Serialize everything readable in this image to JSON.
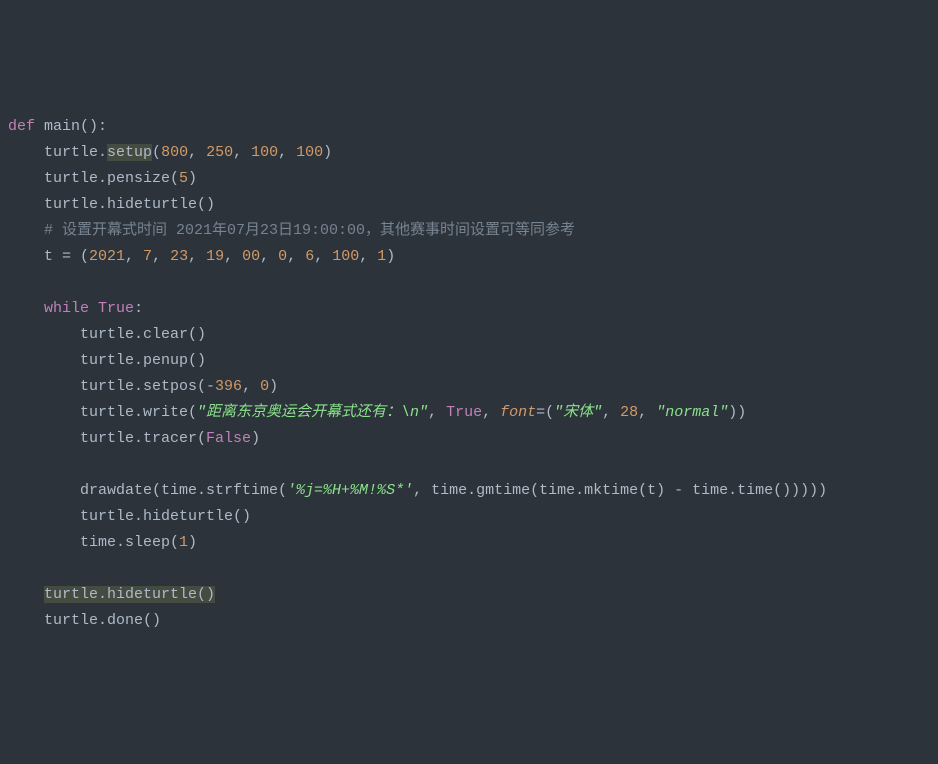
{
  "code": {
    "l1": {
      "def": "def",
      "name": "main",
      "rest": "():"
    },
    "l2": {
      "p1": "    turtle.",
      "hl": "setup",
      "p2": "(",
      "n1": "800",
      "c1": ", ",
      "n2": "250",
      "c2": ", ",
      "n3": "100",
      "c3": ", ",
      "n4": "100",
      "p3": ")"
    },
    "l3": {
      "p1": "    turtle.pensize(",
      "n1": "5",
      "p2": ")"
    },
    "l4": {
      "p1": "    turtle.hideturtle()"
    },
    "l5": {
      "cmt": "    # 设置开幕式时间 2021年07月23日19:00:00，其他赛事时间设置可等同参考"
    },
    "l6": {
      "p1": "    t = (",
      "n1": "2021",
      "c": ", ",
      "n2": "7",
      "n3": "23",
      "n4": "19",
      "n5": "00",
      "n6": "0",
      "n7": "6",
      "n8": "100",
      "n9": "1",
      "p2": ")"
    },
    "l7": {
      "blank": ""
    },
    "l8": {
      "ind": "    ",
      "kw": "while",
      "sp": " ",
      "true": "True",
      "col": ":"
    },
    "l9": {
      "p1": "        turtle.clear()"
    },
    "l10": {
      "p1": "        turtle.penup()"
    },
    "l11": {
      "p1": "        turtle.setpos(-",
      "n1": "396",
      "c": ", ",
      "n2": "0",
      "p2": ")"
    },
    "l12": {
      "p1": "        turtle.write(",
      "s1": "\"距离东京奥运会开幕式还有：\\n\"",
      "c1": ", ",
      "true": "True",
      "c2": ", ",
      "kwarg": "font",
      "eq": "=(",
      "s2": "\"宋体\"",
      "c3": ", ",
      "n1": "28",
      "c4": ", ",
      "s3": "\"normal\"",
      "p2": "))"
    },
    "l13": {
      "p1": "        turtle.tracer(",
      "false": "False",
      "p2": ")"
    },
    "l14": {
      "blank": ""
    },
    "l15": {
      "p1": "        drawdate(time.strftime(",
      "s1": "'%j=%H+%M!%S*'",
      "c1": ", time.gmtime(time.mktime(t) - time.time()))))"
    },
    "l16": {
      "p1": "        turtle.hideturtle()"
    },
    "l17": {
      "p1": "        time.sleep(",
      "n1": "1",
      "p2": ")"
    },
    "l18": {
      "blank": ""
    },
    "l19": {
      "ind": "    ",
      "hl": "turtle.hideturtle()"
    },
    "l20": {
      "p1": "    turtle.done()"
    }
  }
}
